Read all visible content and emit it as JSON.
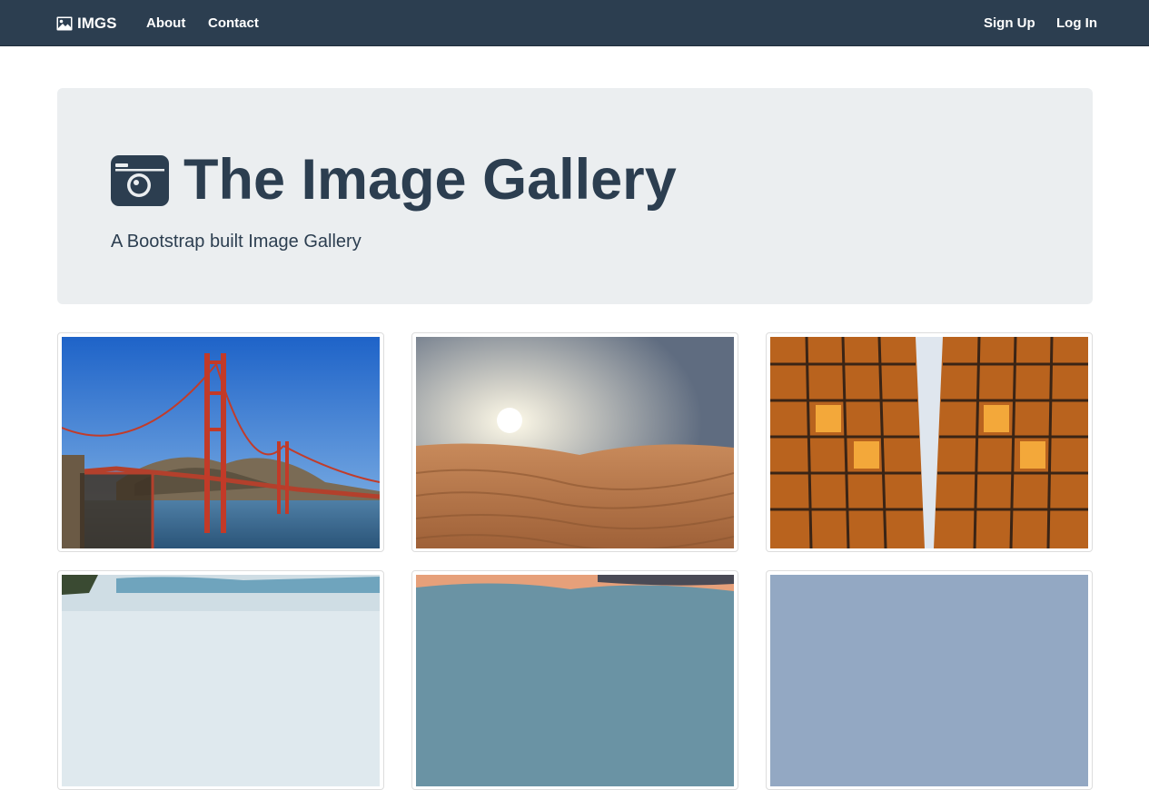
{
  "navbar": {
    "brand": "IMGS",
    "links": [
      "About",
      "Contact"
    ],
    "right_links": [
      "Sign Up",
      "Log In"
    ]
  },
  "jumbotron": {
    "title": "The Image Gallery",
    "subtitle": "A Bootstrap built Image Gallery"
  },
  "gallery": {
    "images": [
      "golden-gate-bridge",
      "desert-dunes",
      "skyscrapers-looking-up",
      "coast-trees",
      "sunset-sky",
      "blue-sky"
    ]
  },
  "colors": {
    "navbar": "#2c3e50",
    "jumbotron": "#ebeef0",
    "text": "#2c3e50"
  }
}
